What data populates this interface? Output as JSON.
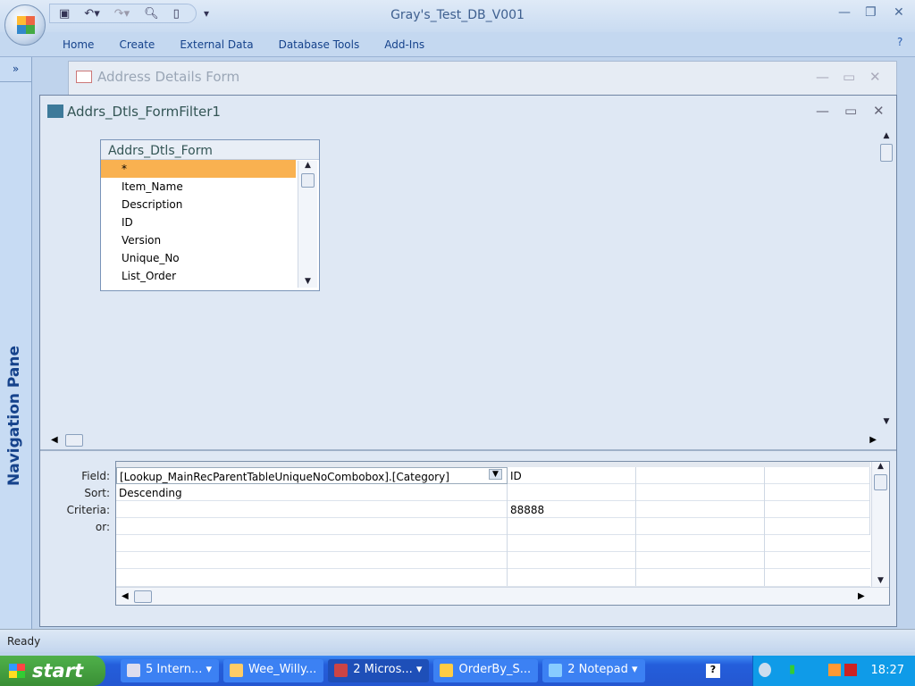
{
  "app": {
    "title": "Gray's_Test_DB_V001"
  },
  "ribbon": {
    "tabs": [
      "Home",
      "Create",
      "External Data",
      "Database Tools",
      "Add-Ins"
    ]
  },
  "nav": {
    "label": "Navigation Pane",
    "expand": "»"
  },
  "window_bg": {
    "title": "Address Details Form"
  },
  "window": {
    "title": "Addrs_Dtls_FormFilter1"
  },
  "fieldlist": {
    "title": "Addrs_Dtls_Form",
    "items": [
      "*",
      "Item_Name",
      "Description",
      "ID",
      "Version",
      "Unique_No",
      "List_Order"
    ]
  },
  "grid": {
    "row_labels": [
      "Field:",
      "Sort:",
      "Criteria:",
      "or:"
    ],
    "columns": [
      {
        "field": "[Lookup_MainRecParentTableUniqueNoCombobox].[Category]",
        "sort": "Descending",
        "criteria": "",
        "or": ""
      },
      {
        "field": "ID",
        "sort": "",
        "criteria": "88888",
        "or": ""
      },
      {
        "field": "",
        "sort": "",
        "criteria": "",
        "or": ""
      },
      {
        "field": "",
        "sort": "",
        "criteria": "",
        "or": ""
      }
    ]
  },
  "status": {
    "text": "Ready"
  },
  "taskbar": {
    "start": "start",
    "items": [
      {
        "label": "5 Intern...",
        "active": false
      },
      {
        "label": "Wee_Willy...",
        "active": false
      },
      {
        "label": "2 Micros...",
        "active": true
      },
      {
        "label": "OrderBy_S...",
        "active": false
      },
      {
        "label": "2 Notepad",
        "active": false
      }
    ],
    "clock": "18:27"
  }
}
